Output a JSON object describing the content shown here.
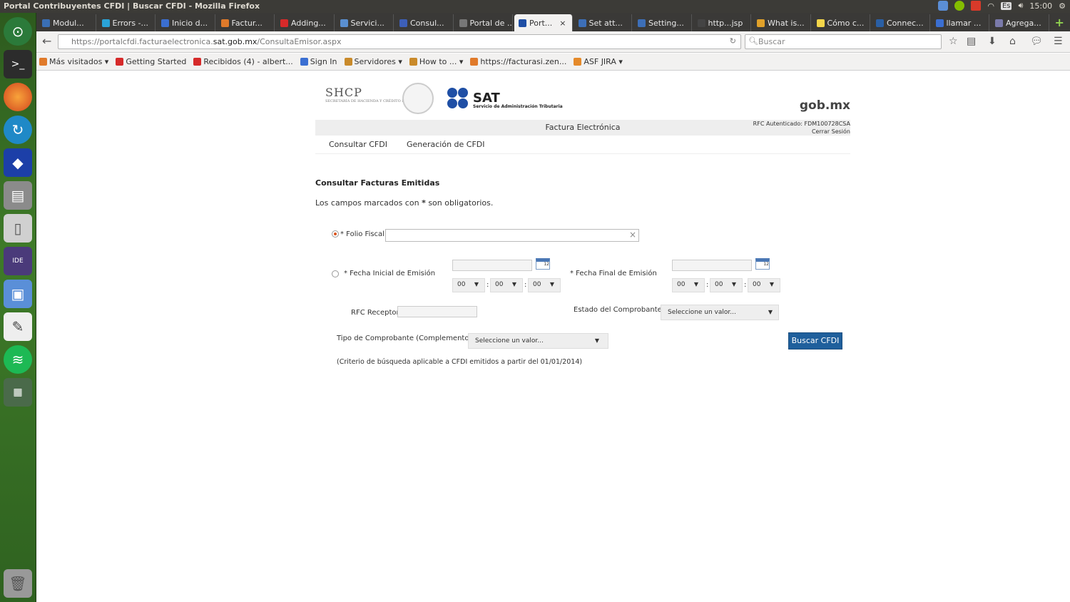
{
  "os": {
    "window_title": "Portal Contribuyentes CFDI | Buscar CFDI - Mozilla Firefox",
    "keyboard": "Es",
    "clock": "15:00"
  },
  "browser": {
    "tabs": [
      {
        "label": "Modul...",
        "color": "#3a6fb5"
      },
      {
        "label": "Errors -...",
        "color": "#2aa3d8"
      },
      {
        "label": "Inicio d...",
        "color": "#3b6fd2"
      },
      {
        "label": "Factur...",
        "color": "#e07a2a"
      },
      {
        "label": "Adding...",
        "color": "#d62a2a"
      },
      {
        "label": "Servici...",
        "color": "#5a8fd0"
      },
      {
        "label": "Consul...",
        "color": "#3d5fb8"
      },
      {
        "label": "Portal de ...",
        "color": "#777777"
      },
      {
        "label": "Port...",
        "color": "#1f4fa5",
        "active": true
      },
      {
        "label": "Set att...",
        "color": "#3d6fb8"
      },
      {
        "label": "Setting...",
        "color": "#3d6fb8"
      },
      {
        "label": "http...jsp",
        "color": "#444444"
      },
      {
        "label": "What is...",
        "color": "#e0a12a"
      },
      {
        "label": "Cómo c...",
        "color": "#f4d64a"
      },
      {
        "label": "Connec...",
        "color": "#2a5fa5"
      },
      {
        "label": "llamar ...",
        "color": "#3b6fd2"
      },
      {
        "label": "Agrega...",
        "color": "#7a7aaa"
      }
    ],
    "url_prefix": "https://portalcfdi.facturaelectronica.",
    "url_domain": "sat.gob.mx",
    "url_path": "/ConsultaEmisor.aspx",
    "search_placeholder": "Buscar",
    "bookmarks": [
      {
        "label": "Más visitados ▾"
      },
      {
        "label": "Getting Started"
      },
      {
        "label": "Recibidos (4) - albert..."
      },
      {
        "label": "Sign In"
      },
      {
        "label": "Servidores ▾"
      },
      {
        "label": "How to ... ▾"
      },
      {
        "label": "https://facturasi.zen..."
      },
      {
        "label": "ASF JIRA ▾"
      }
    ]
  },
  "header": {
    "shcp": "SHCP",
    "shcp_sub": "SECRETARÍA DE HACIENDA Y CRÉDITO PÚBLICO",
    "sat": "SAT",
    "sat_sub": "Servicio de Administración Tributaria",
    "gobmx": "gob.mx",
    "bar_title": "Factura Electrónica",
    "rfc_auth": "RFC Autenticado: FDM100728CSA",
    "logout": "Cerrar Sesión"
  },
  "menu": {
    "consultar": "Consultar CFDI",
    "generacion": "Generación de CFDI"
  },
  "form": {
    "title": "Consultar Facturas Emitidas",
    "note_before": "Los campos marcados con",
    "note_star": "*",
    "note_after": "son obligatorios.",
    "folio_label": "* Folio Fiscal",
    "fecha_inicial_label": "* Fecha Inicial de Emisión",
    "fecha_final_label": "* Fecha Final de Emisión",
    "time_value": "00",
    "time_sep": ":",
    "calendar_day": "12",
    "rfc_receptor_label": "RFC Receptor",
    "estado_label": "Estado del Comprobante",
    "estado_value": "Seleccione un valor...",
    "tipo_label": "Tipo de Comprobante (Complemento)",
    "tipo_value": "Seleccione un valor...",
    "buscar": "Buscar CFDI",
    "criterio": "(Criterio de búsqueda aplicable a CFDI emitidos a partir del 01/01/2014)"
  }
}
